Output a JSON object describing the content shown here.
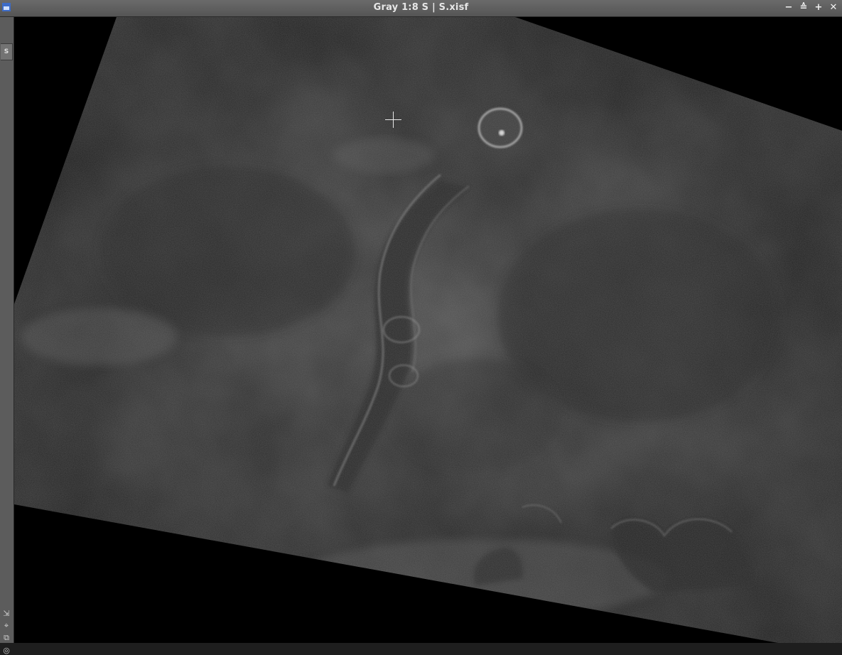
{
  "window": {
    "title": "Gray 1:8 S | S.xisf",
    "controls": {
      "minimize_icon": "−",
      "shade_icon": "≙",
      "maximize_icon": "+",
      "close_icon": "✕"
    }
  },
  "sidebar": {
    "view_tab_label": "S",
    "tools": [
      {
        "name": "zoom-to-fit-icon",
        "glyph": "⇲"
      },
      {
        "name": "fit-view-icon",
        "glyph": "⌖"
      },
      {
        "name": "new-instance-icon",
        "glyph": "⧉"
      },
      {
        "name": "target-icon",
        "glyph": "◎"
      }
    ]
  },
  "colors": {
    "image_background": "#000000",
    "nebula_base": "#3c3c3c",
    "titlebar": "#5f5f5f",
    "accent": "#3d6cc8"
  }
}
